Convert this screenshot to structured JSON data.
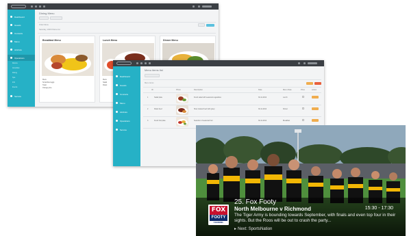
{
  "window1": {
    "title": "Dining Menu",
    "subtitle": "Saturday, 1936 8 Menu list",
    "button_label": "",
    "filter_label": "Order Menu",
    "sidebar_items": [
      "Dashboard",
      "Guests",
      "Concerts",
      "Menu",
      "Airshots",
      "Operations",
      "Service"
    ],
    "sidebar_sub": [
      "Rooms",
      "Amenities",
      "Dining",
      "Spa",
      "Info",
      "Events"
    ],
    "cards": [
      {
        "title": "Breakfast Menu",
        "meta": [
          "Menu",
          "Scrambled eggs",
          "Toast",
          "Orange juice"
        ]
      },
      {
        "title": "Lunch Menu",
        "meta": [
          "Menu",
          "Salad",
          "Roast"
        ]
      },
      {
        "title": "Dinner Menu",
        "meta": []
      }
    ]
  },
  "window2": {
    "title": "Menu items list",
    "filter_label": "Menu items",
    "sidebar_items": [
      "Dashboard",
      "Guests",
      "Concerts",
      "Menu",
      "Airshots",
      "Operations",
      "Service"
    ],
    "columns": [
      "ID",
      "Photo",
      "Description",
      "Date",
      "Menu Date",
      "Price",
      "Action"
    ],
    "rows": [
      {
        "id": "1",
        "name": "Salad plate",
        "desc": "Fresh salad with seasonal vegetables",
        "date": "30-11-2012",
        "menu": "Lunch"
      },
      {
        "id": "2",
        "name": "Roast beef",
        "desc": "Slow roasted beef with gravy",
        "date": "30-11-2012",
        "menu": "Dinner"
      },
      {
        "id": "3",
        "name": "Fresh fruit plate",
        "desc": "Selection of seasonal fruit",
        "date": "30-11-2012",
        "menu": "Breakfast"
      }
    ]
  },
  "tv": {
    "logo_top": "FOX",
    "logo_mid": "FOOTY",
    "logo_bot": "CHANNEL",
    "channel": "25. Fox Footy",
    "program": "North Melbourne v Richmond",
    "time": "15:30 - 17:30",
    "description": "The Tiger Army is bounding towards September, with finals and even top four in their sights. But the Roos will be out to crash the party...",
    "next": "Next: SportsNation"
  },
  "colors": {
    "sidebar": "#26b1c6",
    "topbar": "#3b3f44",
    "fox_red": "#c8102e",
    "fox_blue": "#0d2a6b",
    "jersey_yellow": "#f2b705"
  }
}
